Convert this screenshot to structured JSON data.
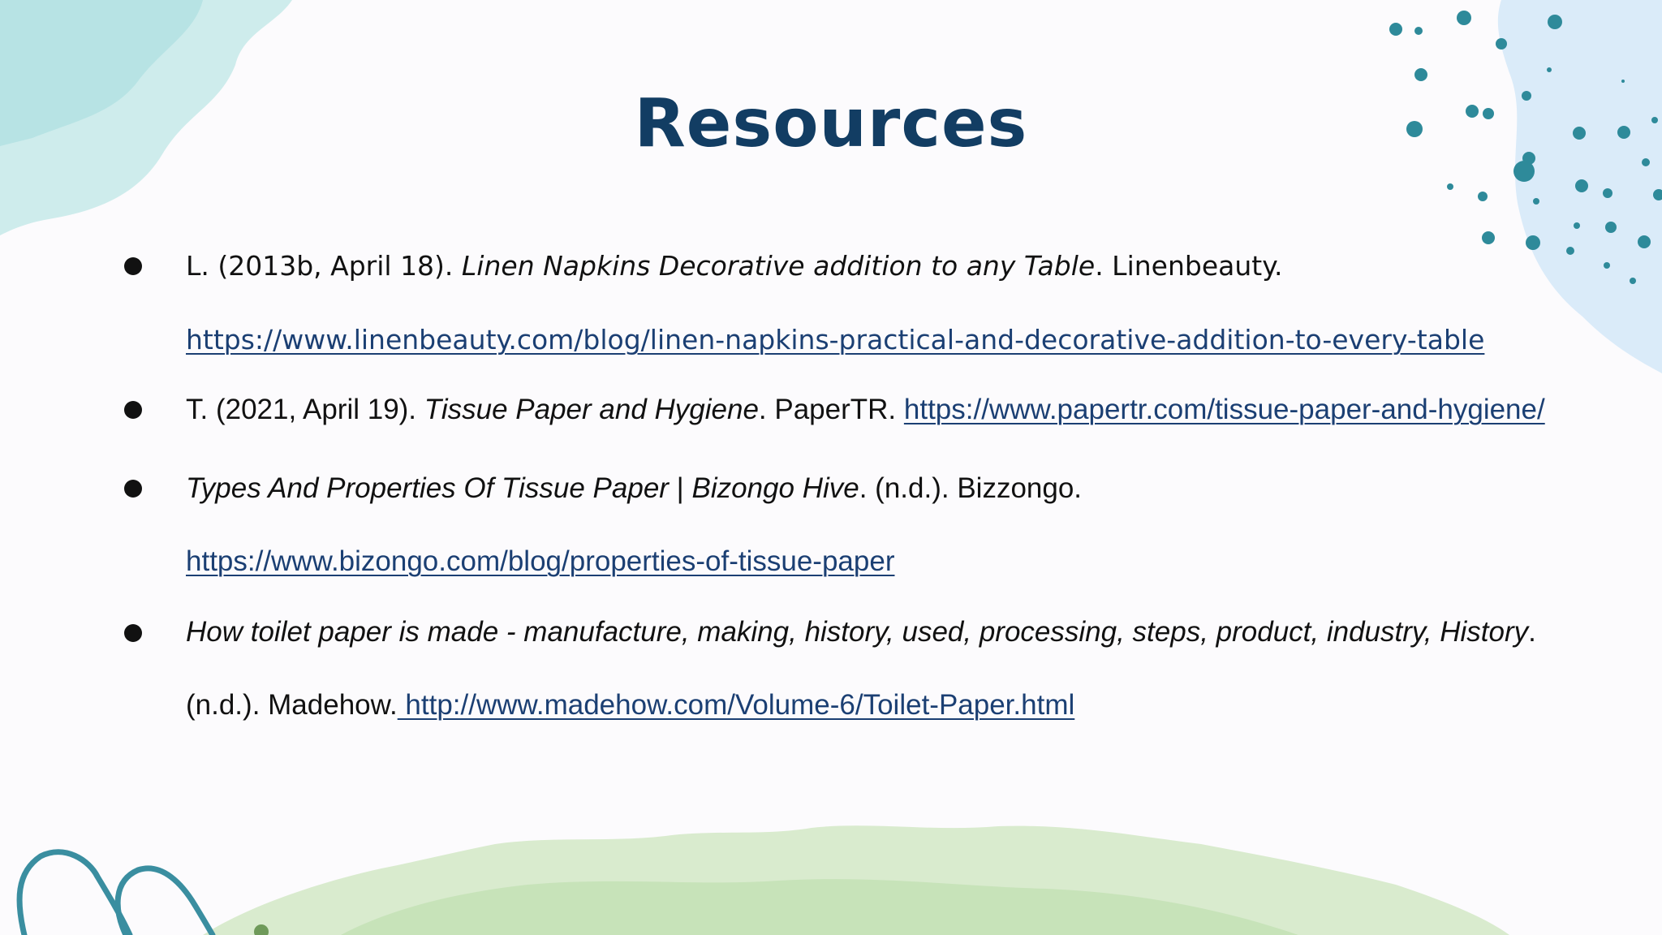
{
  "title": "Resources",
  "references": [
    {
      "author_date": "L. (2013b, April 18). ",
      "title": "Linen Napkins Decorative addition to any Table",
      "publisher": ". Linenbeauty.",
      "url": "https://www.linenbeauty.com/blog/linen-napkins-practical-and-decorative-addition-to-every-table"
    },
    {
      "author_date": "T. (2021, April 19). ",
      "title": "Tissue Paper and Hygiene",
      "publisher": ". PaperTR. ",
      "url": "https://www.papertr.com/tissue-paper-and-hygiene/"
    },
    {
      "title_part1": "Types And Properties Of Tissue Paper",
      "separator": " | ",
      "title_part2": "Bizongo Hive",
      "publisher": ". (n.d.). Bizzongo.",
      "url": "https://www.bizongo.com/blog/properties-of-tissue-paper"
    },
    {
      "title": "How toilet paper is made - manufacture, making, history, used, processing, steps, product, industry, History",
      "title_end": ".",
      "publisher": "(n.d.). Madehow.",
      "url": " http://www.madehow.com/Volume-6/Toilet-Paper.html"
    }
  ],
  "colors": {
    "title": "#123d63",
    "link": "#1b3f73",
    "text": "#111111",
    "teal_dots": "#2e8a9a",
    "swirl": "#3a8ea0"
  }
}
